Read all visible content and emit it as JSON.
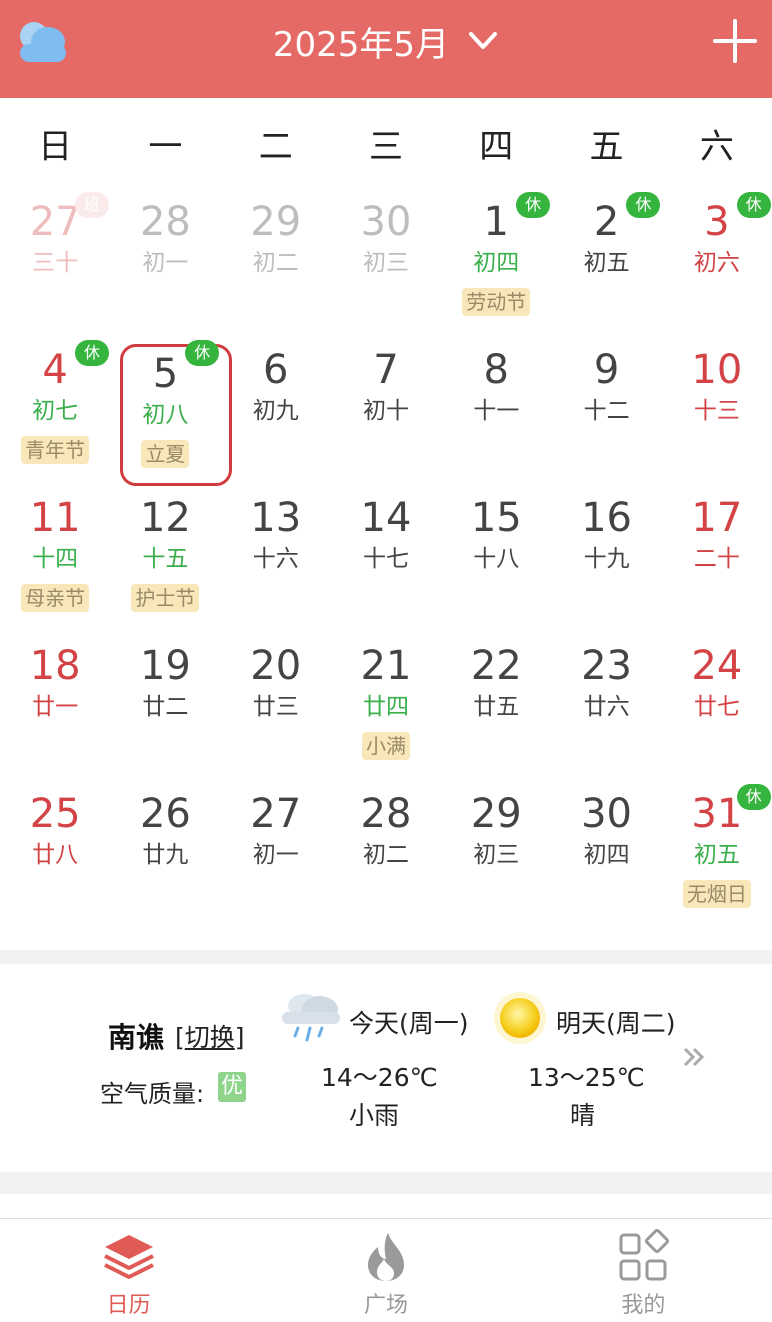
{
  "header": {
    "title": "2025年5月",
    "icons": {
      "weather": "cloud-icon",
      "dropdown": "chevron-down-icon",
      "add": "plus-icon"
    }
  },
  "colors": {
    "brand": "#e56a66",
    "holiday_red": "#d34244",
    "lunar_green": "#3aaf4b",
    "rest_badge": "#35b53d",
    "festival_bg": "#f8e7b8"
  },
  "weekdays": [
    "日",
    "一",
    "二",
    "三",
    "四",
    "五",
    "六"
  ],
  "days": [
    {
      "num": "27",
      "lunar": "三十",
      "other": true,
      "red": true,
      "badge": "班"
    },
    {
      "num": "28",
      "lunar": "初一",
      "other": true
    },
    {
      "num": "29",
      "lunar": "初二",
      "other": true
    },
    {
      "num": "30",
      "lunar": "初三",
      "other": true
    },
    {
      "num": "1",
      "lunar": "初四",
      "green": true,
      "badge": "休",
      "festival": "劳动节"
    },
    {
      "num": "2",
      "lunar": "初五",
      "badge": "休"
    },
    {
      "num": "3",
      "lunar": "初六",
      "red": true,
      "badge": "休"
    },
    {
      "num": "4",
      "lunar": "初七",
      "red": true,
      "green": true,
      "badge": "休",
      "festival": "青年节"
    },
    {
      "num": "5",
      "lunar": "初八",
      "green": true,
      "badge": "休",
      "festival": "立夏",
      "today": true
    },
    {
      "num": "6",
      "lunar": "初九"
    },
    {
      "num": "7",
      "lunar": "初十"
    },
    {
      "num": "8",
      "lunar": "十一"
    },
    {
      "num": "9",
      "lunar": "十二"
    },
    {
      "num": "10",
      "lunar": "十三",
      "red": true
    },
    {
      "num": "11",
      "lunar": "十四",
      "red": true,
      "green": true,
      "festival": "母亲节"
    },
    {
      "num": "12",
      "lunar": "十五",
      "green": true,
      "festival": "护士节"
    },
    {
      "num": "13",
      "lunar": "十六"
    },
    {
      "num": "14",
      "lunar": "十七"
    },
    {
      "num": "15",
      "lunar": "十八"
    },
    {
      "num": "16",
      "lunar": "十九"
    },
    {
      "num": "17",
      "lunar": "二十",
      "red": true
    },
    {
      "num": "18",
      "lunar": "廿一",
      "red": true
    },
    {
      "num": "19",
      "lunar": "廿二"
    },
    {
      "num": "20",
      "lunar": "廿三"
    },
    {
      "num": "21",
      "lunar": "廿四",
      "green": true,
      "festival": "小满"
    },
    {
      "num": "22",
      "lunar": "廿五"
    },
    {
      "num": "23",
      "lunar": "廿六"
    },
    {
      "num": "24",
      "lunar": "廿七",
      "red": true
    },
    {
      "num": "25",
      "lunar": "廿八",
      "red": true
    },
    {
      "num": "26",
      "lunar": "廿九"
    },
    {
      "num": "27",
      "lunar": "初一"
    },
    {
      "num": "28",
      "lunar": "初二"
    },
    {
      "num": "29",
      "lunar": "初三"
    },
    {
      "num": "30",
      "lunar": "初四"
    },
    {
      "num": "31",
      "lunar": "初五",
      "red": true,
      "green": true,
      "badge": "休",
      "festival": "无烟日"
    }
  ],
  "weather": {
    "city": "南谯",
    "switch_open": "[",
    "switch_label": "切换",
    "switch_close": "]",
    "aqi_label": "空气质量:",
    "aqi_value": "优",
    "today": {
      "name": "今天(周一)",
      "temp": "14～26℃",
      "desc": "小雨",
      "icon": "rain-cloud-icon"
    },
    "tomorrow": {
      "name": "明天(周二)",
      "temp": "13～25℃",
      "desc": "晴",
      "icon": "sun-icon"
    },
    "more_icon": "double-chevron-right-icon"
  },
  "nav": [
    {
      "label": "日历",
      "icon": "layers-icon",
      "active": true
    },
    {
      "label": "广场",
      "icon": "flame-icon",
      "active": false
    },
    {
      "label": "我的",
      "icon": "grid-apps-icon",
      "active": false
    }
  ]
}
